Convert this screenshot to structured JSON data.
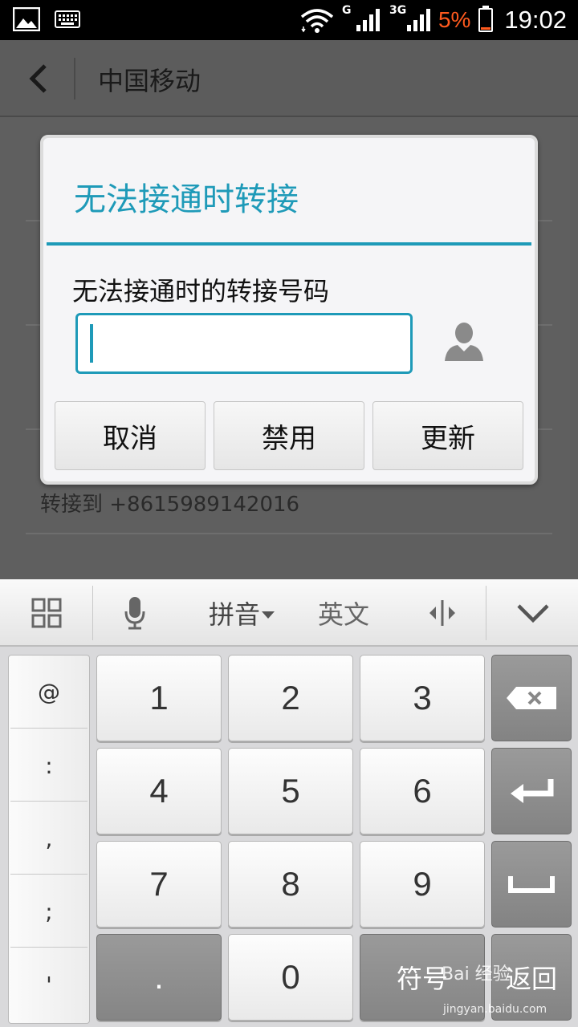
{
  "status_bar": {
    "network_g": "G",
    "network_3g": "3G",
    "battery_percent": "5%",
    "time": "19:02",
    "icons": [
      "gallery-icon",
      "keyboard-icon",
      "wifi-icon",
      "signal-icon",
      "battery-icon"
    ]
  },
  "action_bar": {
    "title": "中国移动"
  },
  "background_screen": {
    "forward_text": "转接到 +8615989142016"
  },
  "dialog": {
    "title": "无法接通时转接",
    "label": "无法接通时的转接号码",
    "input_value": "",
    "buttons": {
      "cancel": "取消",
      "disable": "禁用",
      "update": "更新"
    },
    "accent_color": "#1e9ab8"
  },
  "keyboard_toolbar": {
    "pinyin": "拼音",
    "english": "英文"
  },
  "keyboard": {
    "symbols": [
      "@",
      ":",
      ",",
      ";",
      "'"
    ],
    "digits": [
      "1",
      "2",
      "3",
      "4",
      "5",
      "6",
      "7",
      "8",
      "9"
    ],
    "dot": ".",
    "zero": "0",
    "symbol_key": "符号",
    "return_key": "返回"
  },
  "watermark": {
    "main": "Bai 经验",
    "url": "jingyan.baidu.com"
  }
}
